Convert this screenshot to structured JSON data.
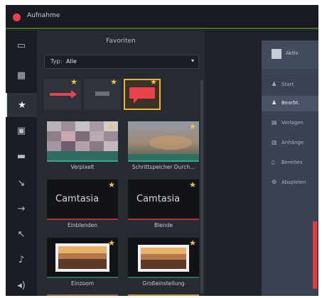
{
  "app": {
    "title": "Aufnahme"
  },
  "rail": {
    "icons": [
      "media-icon",
      "library-icon",
      "favorites-icon",
      "annotations-icon",
      "transitions-icon",
      "behaviors-icon",
      "animations-icon",
      "cursor-icon",
      "audio-icon",
      "voice-icon"
    ]
  },
  "panel": {
    "title": "Favoriten",
    "filter_label": "Typ:",
    "filter_value": "Alle",
    "items": [
      {
        "label": "Verpixelt"
      },
      {
        "label": "Schrittspeicher Durch..."
      },
      {
        "label": "Einblenden"
      },
      {
        "label": "Blende"
      },
      {
        "label": "Einzoom"
      },
      {
        "label": "Großeinstellung"
      }
    ],
    "camtasia_text": "Camtasia"
  },
  "right": {
    "header": "Aktiv",
    "items": [
      {
        "label": "Start"
      },
      {
        "label": "Bearbt."
      },
      {
        "label": "Vorlagen"
      },
      {
        "label": "Anhänge"
      },
      {
        "label": "Bereiten"
      },
      {
        "label": "Abspielen"
      }
    ]
  },
  "colors": {
    "accent": "#e8b43c",
    "record": "#e8434a",
    "titlebar_rule": "#4b6b1f"
  }
}
